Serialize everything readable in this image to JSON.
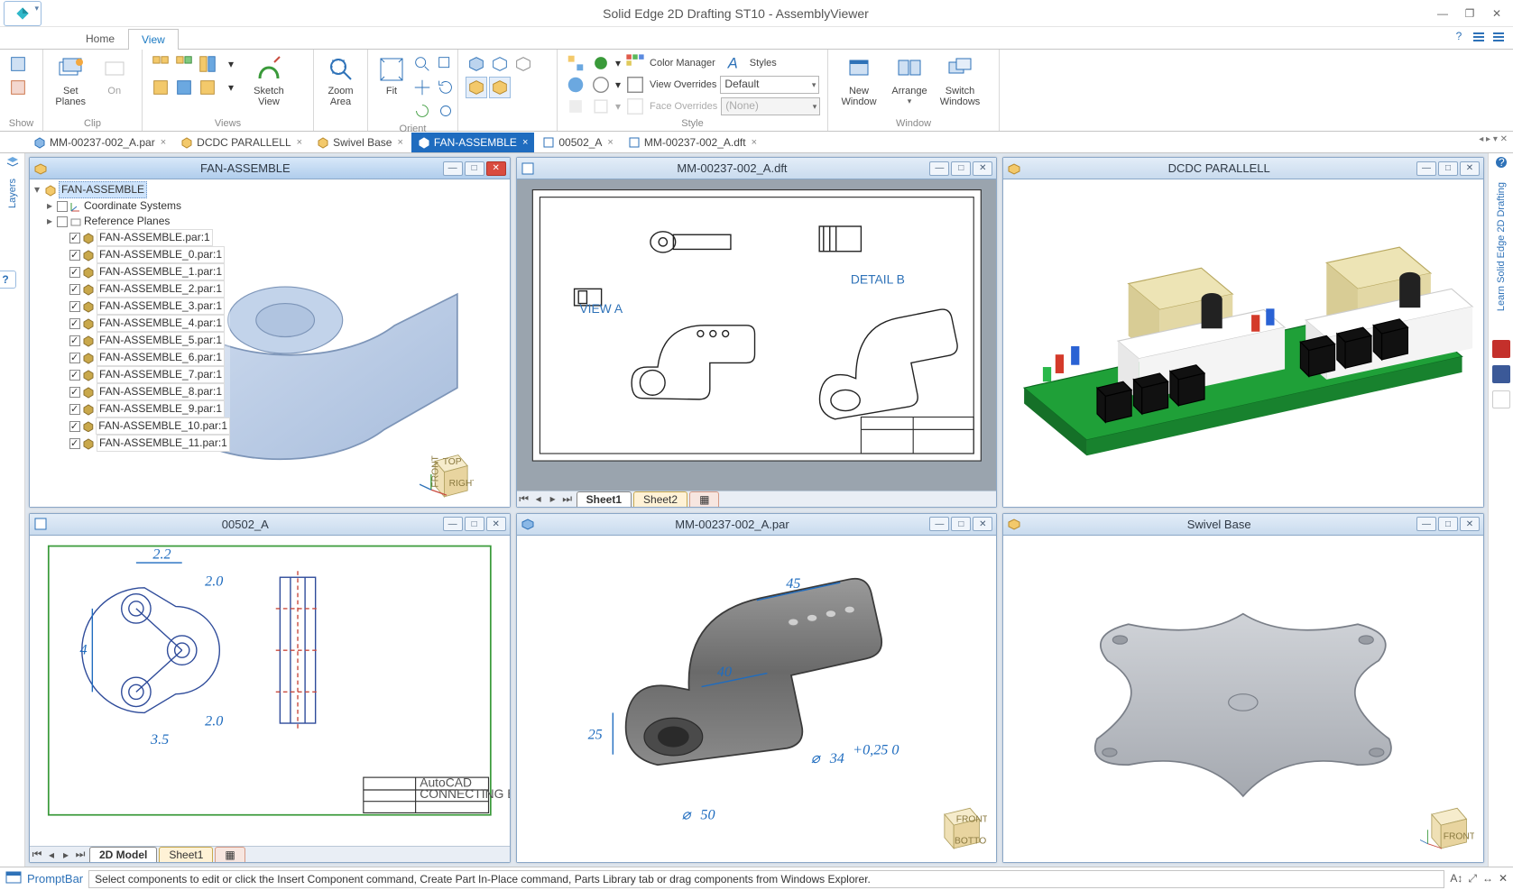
{
  "app": {
    "title": "Solid Edge 2D Drafting ST10 - AssemblyViewer"
  },
  "menu": {
    "tabs": [
      "Home",
      "View"
    ],
    "active": "View"
  },
  "ribbon": {
    "groups": {
      "show": {
        "label": "Show"
      },
      "clip": {
        "label": "Clip",
        "set_planes": "Set\nPlanes",
        "on": "On"
      },
      "views": {
        "label": "Views",
        "sketch_view": "Sketch\nView"
      },
      "zoom": {
        "label": "",
        "zoom_area": "Zoom\nArea"
      },
      "fit": {
        "label": "",
        "fit": "Fit"
      },
      "orient": {
        "label": "Orient"
      },
      "style": {
        "label": "Style",
        "color_manager": "Color Manager",
        "styles": "Styles",
        "view_overrides": "View Overrides",
        "face_overrides": "Face Overrides",
        "combo_default": "Default",
        "combo_none": "(None)"
      },
      "window": {
        "label": "Window",
        "new_window": "New\nWindow",
        "arrange": "Arrange",
        "switch_windows": "Switch\nWindows"
      }
    }
  },
  "doc_tabs": [
    {
      "label": "MM-00237-002_A.par",
      "icon": "part"
    },
    {
      "label": "DCDC PARALLELL",
      "icon": "asm"
    },
    {
      "label": "Swivel Base",
      "icon": "asm"
    },
    {
      "label": "FAN-ASSEMBLE",
      "icon": "asm",
      "active": true
    },
    {
      "label": "00502_A",
      "icon": "dft"
    },
    {
      "label": "MM-00237-002_A.dft",
      "icon": "dft"
    }
  ],
  "left_rail": {
    "layers": "Layers"
  },
  "right_rail": {
    "learn": "Learn Solid Edge 2D Drafting"
  },
  "children": {
    "w1": {
      "title": "FAN-ASSEMBLE"
    },
    "w2": {
      "title": "MM-00237-002_A.dft",
      "sheets": [
        "Sheet1",
        "Sheet2"
      ]
    },
    "w3": {
      "title": "DCDC PARALLELL"
    },
    "w4": {
      "title": "00502_A",
      "sheets": [
        "2D Model",
        "Sheet1"
      ]
    },
    "w5": {
      "title": "MM-00237-002_A.par",
      "dims": {
        "d1": "45",
        "d2": "40",
        "d3": "25",
        "d4": "34",
        "d5": "50",
        "tol": "+0,25\n0"
      }
    },
    "w6": {
      "title": "Swivel Base"
    }
  },
  "tree": {
    "root": "FAN-ASSEMBLE",
    "coord": "Coordinate Systems",
    "ref": "Reference Planes",
    "parts": [
      "FAN-ASSEMBLE.par:1",
      "FAN-ASSEMBLE_0.par:1",
      "FAN-ASSEMBLE_1.par:1",
      "FAN-ASSEMBLE_2.par:1",
      "FAN-ASSEMBLE_3.par:1",
      "FAN-ASSEMBLE_4.par:1",
      "FAN-ASSEMBLE_5.par:1",
      "FAN-ASSEMBLE_6.par:1",
      "FAN-ASSEMBLE_7.par:1",
      "FAN-ASSEMBLE_8.par:1",
      "FAN-ASSEMBLE_9.par:1",
      "FAN-ASSEMBLE_10.par:1",
      "FAN-ASSEMBLE_11.par:1"
    ]
  },
  "view_cubes": {
    "w1": {
      "top": "TOP",
      "front": "FRONT",
      "right": "RIGHT"
    },
    "w5": {
      "front": "FRONT",
      "bottom": "BOTTOM"
    },
    "w6": {
      "front": "FRONT"
    }
  },
  "status": {
    "prompt_label": "PromptBar",
    "prompt": "Select components to edit or click the Insert Component command, Create Part In-Place command, Parts Library tab or drag components from Windows Explorer."
  }
}
